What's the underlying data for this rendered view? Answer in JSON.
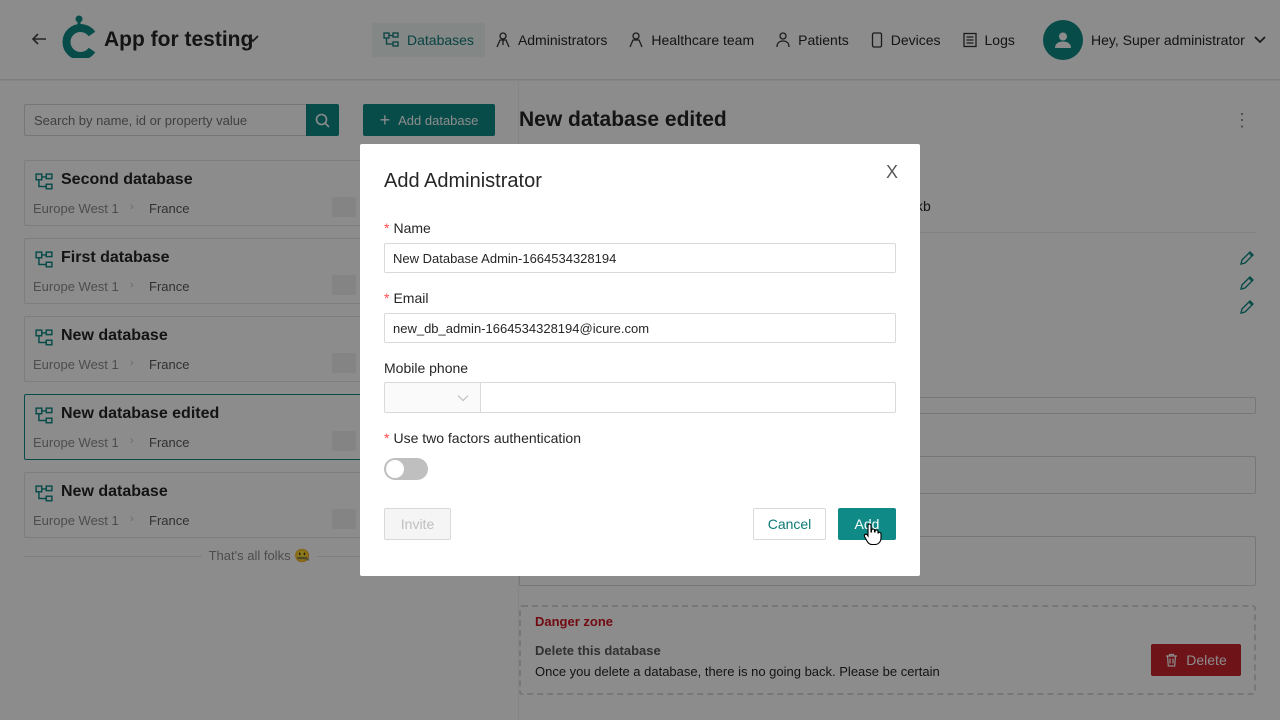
{
  "header": {
    "back_icon": "arrow-left-icon",
    "app_title": "App for testing",
    "nav": [
      {
        "label": "Databases",
        "icon": "database-icon",
        "active": true
      },
      {
        "label": "Administrators",
        "icon": "administrator-icon",
        "active": false
      },
      {
        "label": "Healthcare team",
        "icon": "healthcare-icon",
        "active": false
      },
      {
        "label": "Patients",
        "icon": "patient-icon",
        "active": false
      },
      {
        "label": "Devices",
        "icon": "device-icon",
        "active": false
      },
      {
        "label": "Logs",
        "icon": "logs-icon",
        "active": false
      }
    ],
    "user_greeting": "Hey, Super administrator"
  },
  "left": {
    "search_placeholder": "Search by name, id or property value",
    "add_database_label": "Add database",
    "databases": [
      {
        "name": "Second database",
        "region": "Europe West 1",
        "country": "France",
        "selected": false
      },
      {
        "name": "First database",
        "region": "Europe West 1",
        "country": "France",
        "selected": false
      },
      {
        "name": "New database",
        "region": "Europe West 1",
        "country": "France",
        "selected": false
      },
      {
        "name": "New database edited",
        "region": "Europe West 1",
        "country": "France",
        "selected": true
      },
      {
        "name": "New database",
        "region": "Europe West 1",
        "country": "France",
        "selected": false
      }
    ],
    "footer_note": "That's all folks 🤐"
  },
  "right": {
    "title": "New database edited",
    "size_fragment": "kb",
    "danger_zone": {
      "title": "Danger zone",
      "subtitle": "Delete this database",
      "description": "Once you delete a database, there is no going back. Please be certain",
      "delete_label": "Delete"
    }
  },
  "modal": {
    "title": "Add Administrator",
    "close_glyph": "X",
    "required_mark": "*",
    "name_label": "Name",
    "name_value": "New Database Admin-1664534328194",
    "email_label": "Email",
    "email_value": "new_db_admin-1664534328194@icure.com",
    "mobile_label": "Mobile phone",
    "two_factor_label": "Use two factors authentication",
    "two_factor_enabled": false,
    "invite_label": "Invite",
    "cancel_label": "Cancel",
    "add_label": "Add"
  },
  "colors": {
    "primary": "#0f8a87",
    "danger": "#c8232c",
    "required": "#ff4d4f"
  }
}
